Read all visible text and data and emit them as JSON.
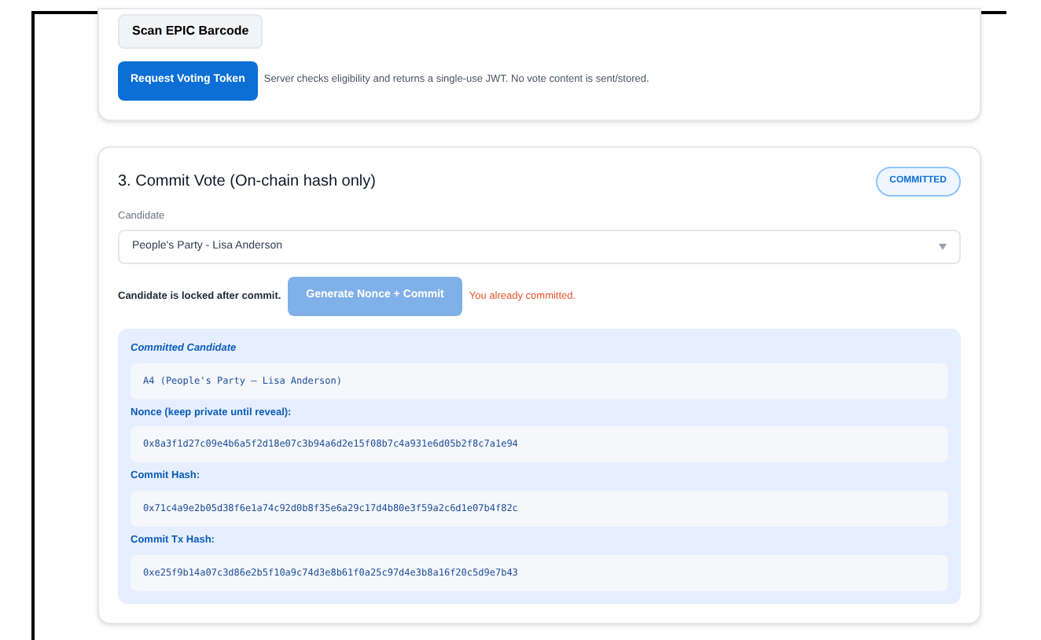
{
  "top_card": {
    "scan_button": "Scan EPIC Barcode",
    "token_button": "Request Voting Token",
    "token_note": "Server checks eligibility and returns a single-use JWT. No vote content is sent/stored."
  },
  "commit_card": {
    "title": "3. Commit Vote (On-chain hash only)",
    "status_badge": "COMMITTED",
    "candidate_label": "Candidate",
    "candidate_value": "People's Party - Lisa Anderson",
    "lock_note": "Candidate is locked after commit.",
    "commit_button": {
      "label": "Generate Nonce + Commit",
      "disabled": true
    },
    "error": "You already committed.",
    "details": [
      {
        "label": "Committed Candidate",
        "value": "A4 (People's Party — Lisa Anderson)"
      },
      {
        "label": "Nonce (keep private until reveal):",
        "value": "0x8a3f1d27c09e4b6a5f2d18e07c3b94a6d2e15f08b7c4a931e6d05b2f8c7a1e94"
      },
      {
        "label": "Commit Hash:",
        "value": "0x71c4a9e2b05d38f6e1a74c92d0b8f35e6a29c17d4b80e3f59a2c6d1e07b4f82c"
      },
      {
        "label": "Commit Tx Hash:",
        "value": "0xe25f9b14a07c3d86e2b5f10a9c74d3e8b61f0a25c97d4e3b8a16f20c5d9e7b43"
      }
    ]
  }
}
